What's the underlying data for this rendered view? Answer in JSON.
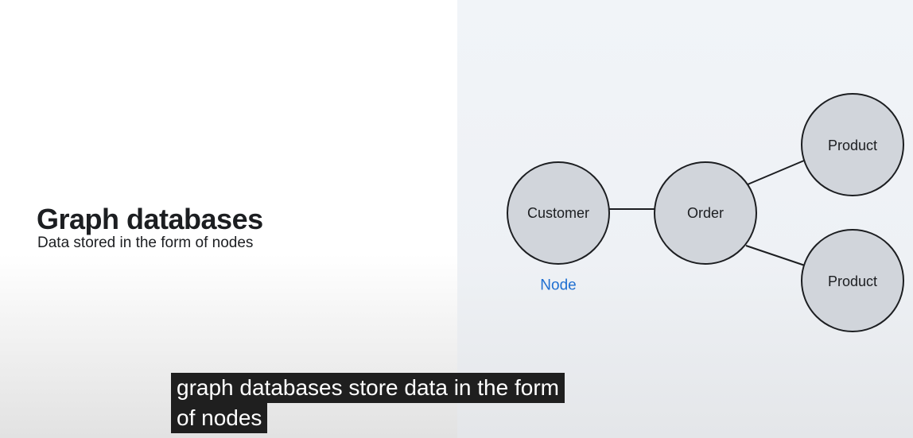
{
  "slide": {
    "title": "Graph databases",
    "subtitle": "Data stored in the form of nodes"
  },
  "diagram": {
    "nodes": [
      {
        "id": "customer",
        "label": "Customer"
      },
      {
        "id": "order",
        "label": "Order"
      },
      {
        "id": "product_top",
        "label": "Product"
      },
      {
        "id": "product_bottom",
        "label": "Product"
      }
    ],
    "edges": [
      {
        "from": "customer",
        "to": "order"
      },
      {
        "from": "order",
        "to": "product_top"
      },
      {
        "from": "order",
        "to": "product_bottom"
      }
    ],
    "legend_label": "Node",
    "colors": {
      "node_fill": "#d1d5db",
      "node_stroke": "#1c1e21",
      "legend": "#1f6fd1"
    }
  },
  "caption": {
    "lines": [
      "graph databases store data in the form",
      "of nodes"
    ]
  }
}
